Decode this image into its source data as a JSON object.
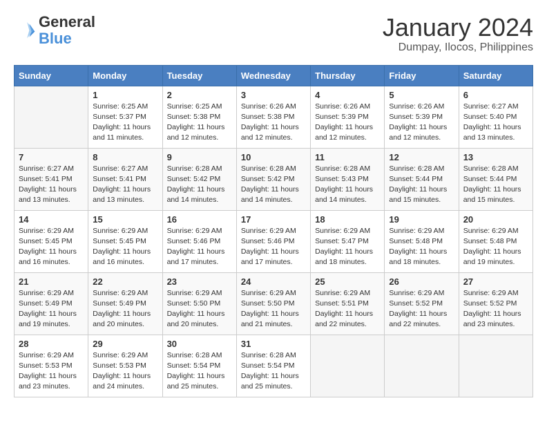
{
  "header": {
    "logo_line1": "General",
    "logo_line2": "Blue",
    "month_title": "January 2024",
    "location": "Dumpay, Ilocos, Philippines"
  },
  "days_of_week": [
    "Sunday",
    "Monday",
    "Tuesday",
    "Wednesday",
    "Thursday",
    "Friday",
    "Saturday"
  ],
  "weeks": [
    [
      {
        "day": "",
        "info": ""
      },
      {
        "day": "1",
        "info": "Sunrise: 6:25 AM\nSunset: 5:37 PM\nDaylight: 11 hours\nand 11 minutes."
      },
      {
        "day": "2",
        "info": "Sunrise: 6:25 AM\nSunset: 5:38 PM\nDaylight: 11 hours\nand 12 minutes."
      },
      {
        "day": "3",
        "info": "Sunrise: 6:26 AM\nSunset: 5:38 PM\nDaylight: 11 hours\nand 12 minutes."
      },
      {
        "day": "4",
        "info": "Sunrise: 6:26 AM\nSunset: 5:39 PM\nDaylight: 11 hours\nand 12 minutes."
      },
      {
        "day": "5",
        "info": "Sunrise: 6:26 AM\nSunset: 5:39 PM\nDaylight: 11 hours\nand 12 minutes."
      },
      {
        "day": "6",
        "info": "Sunrise: 6:27 AM\nSunset: 5:40 PM\nDaylight: 11 hours\nand 13 minutes."
      }
    ],
    [
      {
        "day": "7",
        "info": "Sunrise: 6:27 AM\nSunset: 5:41 PM\nDaylight: 11 hours\nand 13 minutes."
      },
      {
        "day": "8",
        "info": "Sunrise: 6:27 AM\nSunset: 5:41 PM\nDaylight: 11 hours\nand 13 minutes."
      },
      {
        "day": "9",
        "info": "Sunrise: 6:28 AM\nSunset: 5:42 PM\nDaylight: 11 hours\nand 14 minutes."
      },
      {
        "day": "10",
        "info": "Sunrise: 6:28 AM\nSunset: 5:42 PM\nDaylight: 11 hours\nand 14 minutes."
      },
      {
        "day": "11",
        "info": "Sunrise: 6:28 AM\nSunset: 5:43 PM\nDaylight: 11 hours\nand 14 minutes."
      },
      {
        "day": "12",
        "info": "Sunrise: 6:28 AM\nSunset: 5:44 PM\nDaylight: 11 hours\nand 15 minutes."
      },
      {
        "day": "13",
        "info": "Sunrise: 6:28 AM\nSunset: 5:44 PM\nDaylight: 11 hours\nand 15 minutes."
      }
    ],
    [
      {
        "day": "14",
        "info": "Sunrise: 6:29 AM\nSunset: 5:45 PM\nDaylight: 11 hours\nand 16 minutes."
      },
      {
        "day": "15",
        "info": "Sunrise: 6:29 AM\nSunset: 5:45 PM\nDaylight: 11 hours\nand 16 minutes."
      },
      {
        "day": "16",
        "info": "Sunrise: 6:29 AM\nSunset: 5:46 PM\nDaylight: 11 hours\nand 17 minutes."
      },
      {
        "day": "17",
        "info": "Sunrise: 6:29 AM\nSunset: 5:46 PM\nDaylight: 11 hours\nand 17 minutes."
      },
      {
        "day": "18",
        "info": "Sunrise: 6:29 AM\nSunset: 5:47 PM\nDaylight: 11 hours\nand 18 minutes."
      },
      {
        "day": "19",
        "info": "Sunrise: 6:29 AM\nSunset: 5:48 PM\nDaylight: 11 hours\nand 18 minutes."
      },
      {
        "day": "20",
        "info": "Sunrise: 6:29 AM\nSunset: 5:48 PM\nDaylight: 11 hours\nand 19 minutes."
      }
    ],
    [
      {
        "day": "21",
        "info": "Sunrise: 6:29 AM\nSunset: 5:49 PM\nDaylight: 11 hours\nand 19 minutes."
      },
      {
        "day": "22",
        "info": "Sunrise: 6:29 AM\nSunset: 5:49 PM\nDaylight: 11 hours\nand 20 minutes."
      },
      {
        "day": "23",
        "info": "Sunrise: 6:29 AM\nSunset: 5:50 PM\nDaylight: 11 hours\nand 20 minutes."
      },
      {
        "day": "24",
        "info": "Sunrise: 6:29 AM\nSunset: 5:50 PM\nDaylight: 11 hours\nand 21 minutes."
      },
      {
        "day": "25",
        "info": "Sunrise: 6:29 AM\nSunset: 5:51 PM\nDaylight: 11 hours\nand 22 minutes."
      },
      {
        "day": "26",
        "info": "Sunrise: 6:29 AM\nSunset: 5:52 PM\nDaylight: 11 hours\nand 22 minutes."
      },
      {
        "day": "27",
        "info": "Sunrise: 6:29 AM\nSunset: 5:52 PM\nDaylight: 11 hours\nand 23 minutes."
      }
    ],
    [
      {
        "day": "28",
        "info": "Sunrise: 6:29 AM\nSunset: 5:53 PM\nDaylight: 11 hours\nand 23 minutes."
      },
      {
        "day": "29",
        "info": "Sunrise: 6:29 AM\nSunset: 5:53 PM\nDaylight: 11 hours\nand 24 minutes."
      },
      {
        "day": "30",
        "info": "Sunrise: 6:28 AM\nSunset: 5:54 PM\nDaylight: 11 hours\nand 25 minutes."
      },
      {
        "day": "31",
        "info": "Sunrise: 6:28 AM\nSunset: 5:54 PM\nDaylight: 11 hours\nand 25 minutes."
      },
      {
        "day": "",
        "info": ""
      },
      {
        "day": "",
        "info": ""
      },
      {
        "day": "",
        "info": ""
      }
    ]
  ]
}
